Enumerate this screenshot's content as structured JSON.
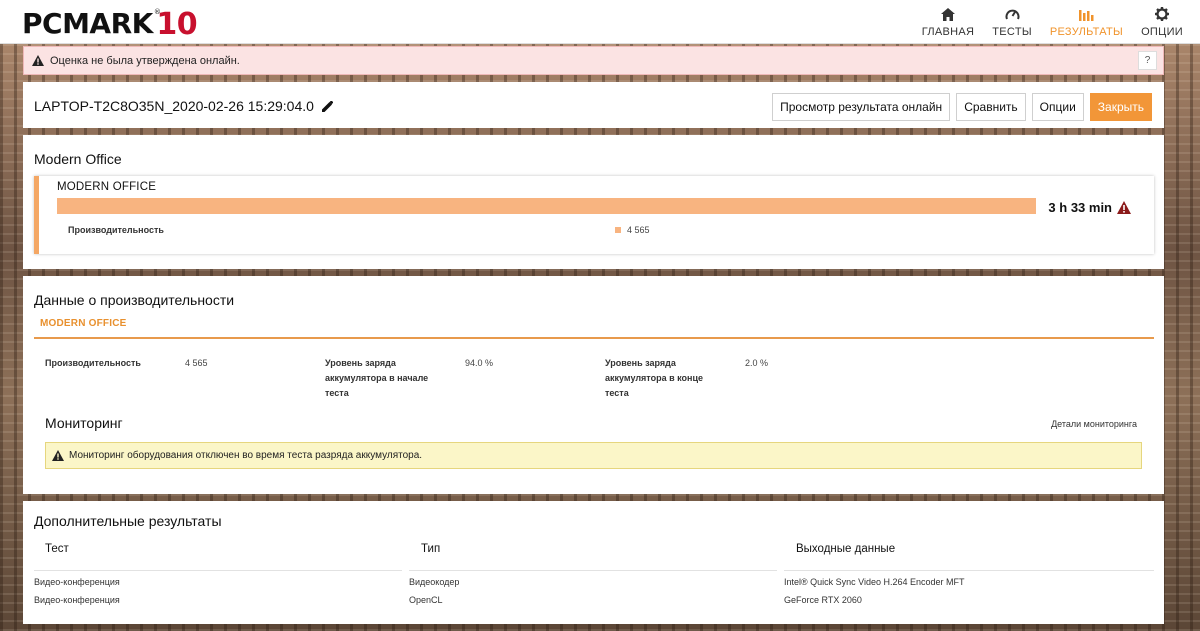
{
  "nav": {
    "logo_main": "PCMARK",
    "logo_ten": "10",
    "logo_reg": "®",
    "items": [
      {
        "label": "ГЛАВНАЯ",
        "icon": "home-icon",
        "active": false
      },
      {
        "label": "ТЕСТЫ",
        "icon": "gauge-icon",
        "active": false
      },
      {
        "label": "РЕЗУЛЬТАТЫ",
        "icon": "bar-chart-icon",
        "active": true
      },
      {
        "label": "ОПЦИИ",
        "icon": "gear-icon",
        "active": false
      }
    ]
  },
  "alert": {
    "text": "Оценка не была утверждена онлайн.",
    "help": "?"
  },
  "result": {
    "title": "LAPTOP-T2C8O35N_2020-02-26 15:29:04.0",
    "buttons": {
      "view_online": "Просмотр результата онлайн",
      "compare": "Сравнить",
      "options": "Опции",
      "close": "Закрыть"
    }
  },
  "modern_office": {
    "section_title": "Modern Office",
    "card_title": "MODERN OFFICE",
    "battery_life": "3 h 33 min",
    "bar_fill": 1.0,
    "metric_label": "Производительность",
    "metric_value": "4 565"
  },
  "perf_data": {
    "section_title": "Данные о производительности",
    "tab": "MODERN OFFICE",
    "items": [
      {
        "label": "Производительность",
        "value": "4 565"
      },
      {
        "label": "Уровень заряда аккумулятора в начале теста",
        "value": "94.0 %"
      },
      {
        "label": "Уровень заряда аккумулятора в конце теста",
        "value": "2.0 %"
      }
    ],
    "monitoring_title": "Мониторинг",
    "monitoring_link": "Детали мониторинга",
    "monitoring_warning": "Мониторинг оборудования отключен во время теста разряда аккумулятора."
  },
  "additional": {
    "section_title": "Дополнительные результаты",
    "columns": [
      "Тест",
      "Тип",
      "Выходные данные"
    ],
    "rows": [
      [
        "Видео-конференция",
        "Видеокодер",
        "Intel® Quick Sync Video H.264 Encoder MFT"
      ],
      [
        "Видео-конференция",
        "OpenCL",
        "GeForce RTX 2060"
      ]
    ]
  },
  "colors": {
    "accent": "#f29638",
    "bar": "#f8b480",
    "warning_icon": "#8b1a1a"
  }
}
